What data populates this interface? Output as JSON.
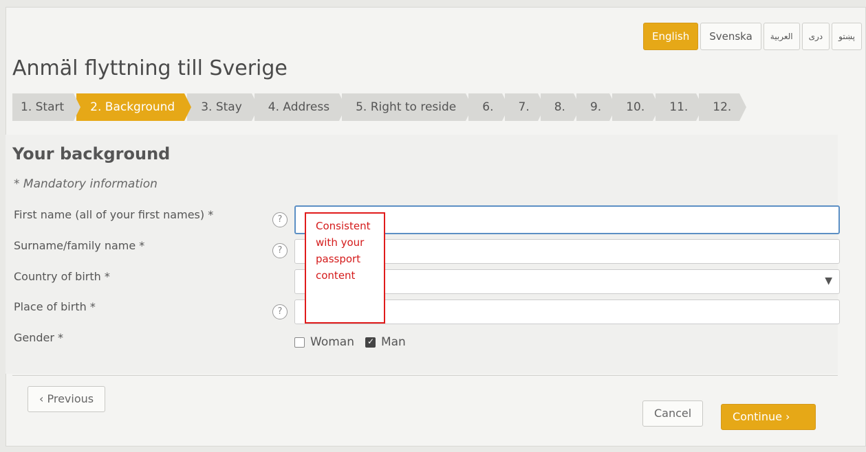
{
  "languages": [
    {
      "label": "English",
      "active": true
    },
    {
      "label": "Svenska",
      "active": false
    },
    {
      "label": "العربية",
      "active": false
    },
    {
      "label": "دری",
      "active": false
    },
    {
      "label": "پښتو",
      "active": false
    }
  ],
  "page_title": "Anmäl flyttning till Sverige",
  "steps": [
    "1. Start",
    "2. Background",
    "3. Stay",
    "4. Address",
    "5. Right to reside",
    "6.",
    "7.",
    "8.",
    "9.",
    "10.",
    "11.",
    "12."
  ],
  "section_title": "Your background",
  "mandatory_note": "* Mandatory information",
  "fields": {
    "first_name_label": "First name (all of your first names) *",
    "surname_label": "Surname/family name *",
    "country_label": "Country of birth *",
    "place_label": "Place of birth *",
    "gender_label": "Gender *"
  },
  "help_icon": "?",
  "tooltip_text": "Consistent with your passport content",
  "gender_options": {
    "woman": "Woman",
    "man": "Man",
    "selected": "Man"
  },
  "buttons": {
    "previous": "‹  Previous",
    "cancel": "Cancel",
    "continue": "Continue  ›"
  },
  "colors": {
    "accent": "#e6a817",
    "tooltip_border": "#e01b1b"
  }
}
